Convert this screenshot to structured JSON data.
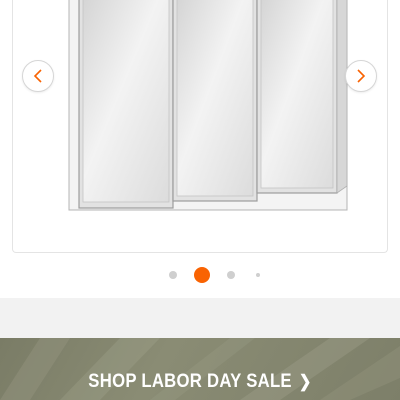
{
  "product_image": {
    "alt": "Tri-view medicine cabinet with three mirrored doors",
    "panels": 3
  },
  "carousel": {
    "prev_icon": "chevron-left-icon",
    "next_icon": "chevron-right-icon",
    "dot_count": 4,
    "active_index": 1,
    "accent_color": "#f96302"
  },
  "promo": {
    "label": "SHOP LABOR DAY SALE",
    "chevron": "❯",
    "background_color": "#808269"
  }
}
